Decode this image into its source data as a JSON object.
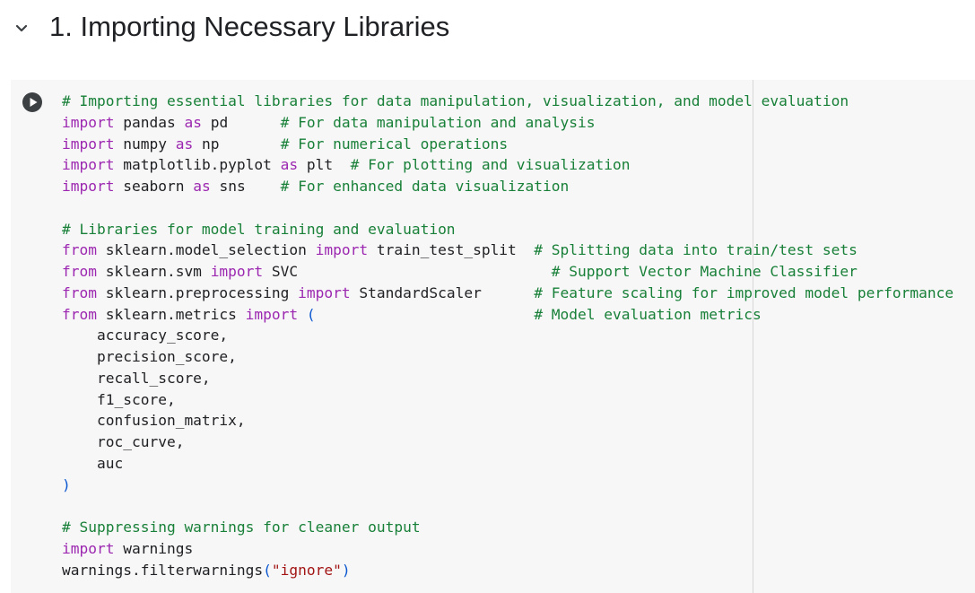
{
  "section": {
    "title": "1. Importing Necessary Libraries",
    "collapse_icon": "chevron-down-icon"
  },
  "cell": {
    "run_icon": "play-circle-icon",
    "lines": [
      [
        {
          "t": "cm",
          "s": "# Importing essential libraries for data manipulation, visualization, and model evaluation"
        }
      ],
      [
        {
          "t": "kw",
          "s": "import"
        },
        {
          "t": "nm",
          "s": " pandas "
        },
        {
          "t": "kw",
          "s": "as"
        },
        {
          "t": "nm",
          "s": " pd      "
        },
        {
          "t": "cm",
          "s": "# For data manipulation and analysis"
        }
      ],
      [
        {
          "t": "kw",
          "s": "import"
        },
        {
          "t": "nm",
          "s": " numpy "
        },
        {
          "t": "kw",
          "s": "as"
        },
        {
          "t": "nm",
          "s": " np       "
        },
        {
          "t": "cm",
          "s": "# For numerical operations"
        }
      ],
      [
        {
          "t": "kw",
          "s": "import"
        },
        {
          "t": "nm",
          "s": " matplotlib.pyplot "
        },
        {
          "t": "kw",
          "s": "as"
        },
        {
          "t": "nm",
          "s": " plt  "
        },
        {
          "t": "cm",
          "s": "# For plotting and visualization"
        }
      ],
      [
        {
          "t": "kw",
          "s": "import"
        },
        {
          "t": "nm",
          "s": " seaborn "
        },
        {
          "t": "kw",
          "s": "as"
        },
        {
          "t": "nm",
          "s": " sns    "
        },
        {
          "t": "cm",
          "s": "# For enhanced data visualization"
        }
      ],
      [],
      [
        {
          "t": "cm",
          "s": "# Libraries for model training and evaluation"
        }
      ],
      [
        {
          "t": "kw",
          "s": "from"
        },
        {
          "t": "nm",
          "s": " sklearn.model_selection "
        },
        {
          "t": "kw",
          "s": "import"
        },
        {
          "t": "nm",
          "s": " train_test_split  "
        },
        {
          "t": "cm",
          "s": "# Splitting data into train/test sets"
        }
      ],
      [
        {
          "t": "kw",
          "s": "from"
        },
        {
          "t": "nm",
          "s": " sklearn.svm "
        },
        {
          "t": "kw",
          "s": "import"
        },
        {
          "t": "nm",
          "s": " SVC                             "
        },
        {
          "t": "cm",
          "s": "# Support Vector Machine Classifier"
        }
      ],
      [
        {
          "t": "kw",
          "s": "from"
        },
        {
          "t": "nm",
          "s": " sklearn.preprocessing "
        },
        {
          "t": "kw",
          "s": "import"
        },
        {
          "t": "nm",
          "s": " StandardScaler      "
        },
        {
          "t": "cm",
          "s": "# Feature scaling for improved model performance"
        }
      ],
      [
        {
          "t": "kw",
          "s": "from"
        },
        {
          "t": "nm",
          "s": " sklearn.metrics "
        },
        {
          "t": "kw",
          "s": "import"
        },
        {
          "t": "nm",
          "s": " "
        },
        {
          "t": "pn",
          "s": "("
        },
        {
          "t": "nm",
          "s": "                         "
        },
        {
          "t": "cm",
          "s": "# Model evaluation metrics"
        }
      ],
      [
        {
          "t": "nm",
          "s": "    accuracy_score,"
        }
      ],
      [
        {
          "t": "nm",
          "s": "    precision_score,"
        }
      ],
      [
        {
          "t": "nm",
          "s": "    recall_score,"
        }
      ],
      [
        {
          "t": "nm",
          "s": "    f1_score,"
        }
      ],
      [
        {
          "t": "nm",
          "s": "    confusion_matrix,"
        }
      ],
      [
        {
          "t": "nm",
          "s": "    roc_curve,"
        }
      ],
      [
        {
          "t": "nm",
          "s": "    auc"
        }
      ],
      [
        {
          "t": "pn",
          "s": ")"
        }
      ],
      [],
      [
        {
          "t": "cm",
          "s": "# Suppressing warnings for cleaner output"
        }
      ],
      [
        {
          "t": "kw",
          "s": "import"
        },
        {
          "t": "nm",
          "s": " warnings"
        }
      ],
      [
        {
          "t": "nm",
          "s": "warnings.filterwarnings"
        },
        {
          "t": "pn",
          "s": "("
        },
        {
          "t": "st",
          "s": "\"ignore\""
        },
        {
          "t": "pn",
          "s": ")"
        }
      ]
    ]
  }
}
